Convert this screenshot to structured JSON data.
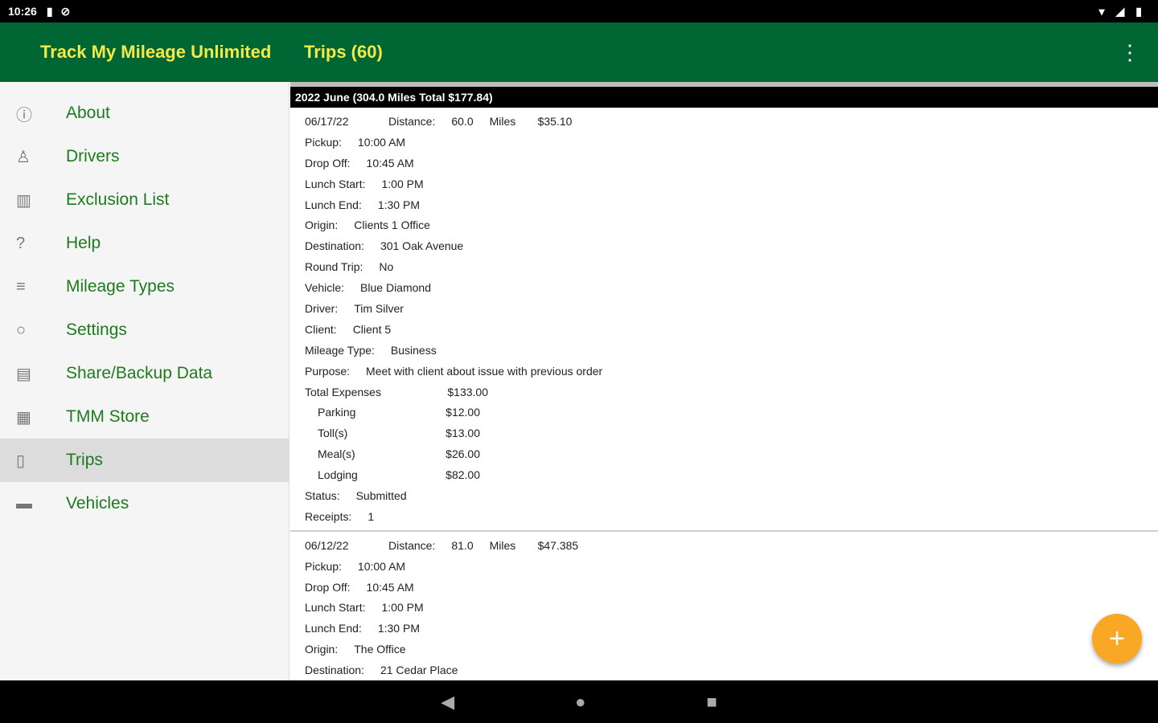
{
  "status_bar": {
    "time": "10:26",
    "icons": [
      "sd-card-icon",
      "sync-icon"
    ],
    "right_icons": [
      "wifi-icon",
      "signal-icon",
      "battery-icon"
    ]
  },
  "app_bar": {
    "app_title": "Track My Mileage Unlimited",
    "screen_title": "Trips (60)",
    "overflow_glyph": "⋮"
  },
  "sidebar": {
    "items": [
      {
        "label": "About",
        "icon": "ⓘ",
        "icon_name": "info-icon"
      },
      {
        "label": "Drivers",
        "icon": "♙",
        "icon_name": "person-icon"
      },
      {
        "label": "Exclusion List",
        "icon": "▥",
        "icon_name": "trash-list-icon"
      },
      {
        "label": "Help",
        "icon": "?",
        "icon_name": "help-icon"
      },
      {
        "label": "Mileage Types",
        "icon": "≡",
        "icon_name": "list-icon"
      },
      {
        "label": "Settings",
        "icon": "○",
        "icon_name": "settings-icon"
      },
      {
        "label": "Share/Backup Data",
        "icon": "▤",
        "icon_name": "share-icon"
      },
      {
        "label": "TMM Store",
        "icon": "▦",
        "icon_name": "store-icon"
      },
      {
        "label": "Trips",
        "icon": "▯",
        "icon_name": "trips-icon",
        "active": true
      },
      {
        "label": "Vehicles",
        "icon": "▬",
        "icon_name": "car-icon"
      }
    ]
  },
  "section_header": "2022 June (304.0 Miles Total $177.84)",
  "trips": [
    {
      "date": "06/17/22",
      "distance_label": "Distance:",
      "distance": "60.0",
      "unit": "Miles",
      "amount": "$35.10",
      "fields": [
        {
          "label": "Pickup:",
          "value": "10:00 AM"
        },
        {
          "label": "Drop Off:",
          "value": "10:45 AM"
        },
        {
          "label": "Lunch Start:",
          "value": "1:00 PM"
        },
        {
          "label": "Lunch End:",
          "value": "1:30 PM"
        },
        {
          "label": "Origin:",
          "value": "Clients 1 Office"
        },
        {
          "label": "Destination:",
          "value": "301 Oak Avenue"
        },
        {
          "label": "Round Trip:",
          "value": "No"
        },
        {
          "label": "Vehicle:",
          "value": "Blue Diamond"
        },
        {
          "label": "Driver:",
          "value": "Tim Silver"
        },
        {
          "label": "Client:",
          "value": "Client 5"
        },
        {
          "label": "Mileage Type:",
          "value": "Business"
        },
        {
          "label": "Purpose:",
          "value": "Meet with client about issue with previous order"
        }
      ],
      "total_expenses_label": "Total Expenses",
      "total_expenses": "$133.00",
      "expenses": [
        {
          "name": "Parking",
          "value": "$12.00"
        },
        {
          "name": "Toll(s)",
          "value": "$13.00"
        },
        {
          "name": "Meal(s)",
          "value": "$26.00"
        },
        {
          "name": "Lodging",
          "value": "$82.00"
        }
      ],
      "tail": [
        {
          "label": "Status:",
          "value": "Submitted"
        },
        {
          "label": "Receipts:",
          "value": "1"
        }
      ]
    },
    {
      "date": "06/12/22",
      "distance_label": "Distance:",
      "distance": "81.0",
      "unit": "Miles",
      "amount": "$47.385",
      "fields": [
        {
          "label": "Pickup:",
          "value": "10:00 AM"
        },
        {
          "label": "Drop Off:",
          "value": "10:45 AM"
        },
        {
          "label": "Lunch Start:",
          "value": "1:00 PM"
        },
        {
          "label": "Lunch End:",
          "value": "1:30 PM"
        },
        {
          "label": "Origin:",
          "value": "The Office"
        },
        {
          "label": "Destination:",
          "value": "21 Cedar Place"
        }
      ]
    }
  ],
  "fab": {
    "glyph": "+"
  },
  "nav_bar": {
    "back": "◀",
    "home": "●",
    "recents": "■"
  }
}
